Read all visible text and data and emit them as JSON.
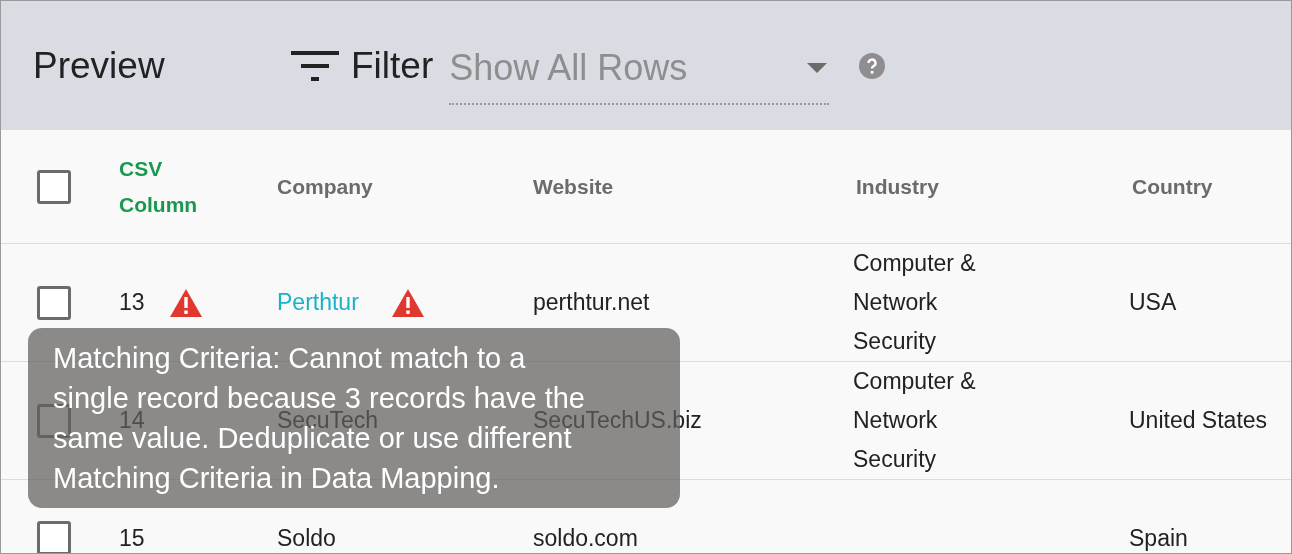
{
  "header": {
    "title": "Preview",
    "filter": {
      "label": "Filter",
      "placeholder": "Show All Rows"
    }
  },
  "table": {
    "columns": [
      {
        "label": "CSV Column",
        "highlighted": true
      },
      {
        "label": "Company",
        "highlighted": false
      },
      {
        "label": "Website",
        "highlighted": false
      },
      {
        "label": "Industry",
        "highlighted": false
      },
      {
        "label": "Country",
        "highlighted": false
      }
    ],
    "all_checked": false,
    "rows": [
      {
        "checked": false,
        "csv_column": "13",
        "csv_warning": true,
        "company": "Perthtur",
        "company_link": true,
        "company_warning": true,
        "website": "perthtur.net",
        "industry": "Computer & Network Security",
        "country": "USA"
      },
      {
        "checked": false,
        "csv_column": "14",
        "csv_warning": false,
        "company": "SecuTech",
        "company_link": false,
        "company_warning": false,
        "website": "SecuTechUS.biz",
        "industry": "Computer & Network Security",
        "country": "United States"
      },
      {
        "checked": false,
        "csv_column": "15",
        "csv_warning": false,
        "company": "Soldo",
        "company_link": false,
        "company_warning": false,
        "website": "soldo.com",
        "country": "Spain"
      }
    ]
  },
  "tooltip": {
    "lines": [
      "Matching Criteria: Cannot match to a",
      "single record because 3 records have the",
      "same value. Deduplicate or use different",
      "Matching Criteria in Data Mapping."
    ]
  }
}
